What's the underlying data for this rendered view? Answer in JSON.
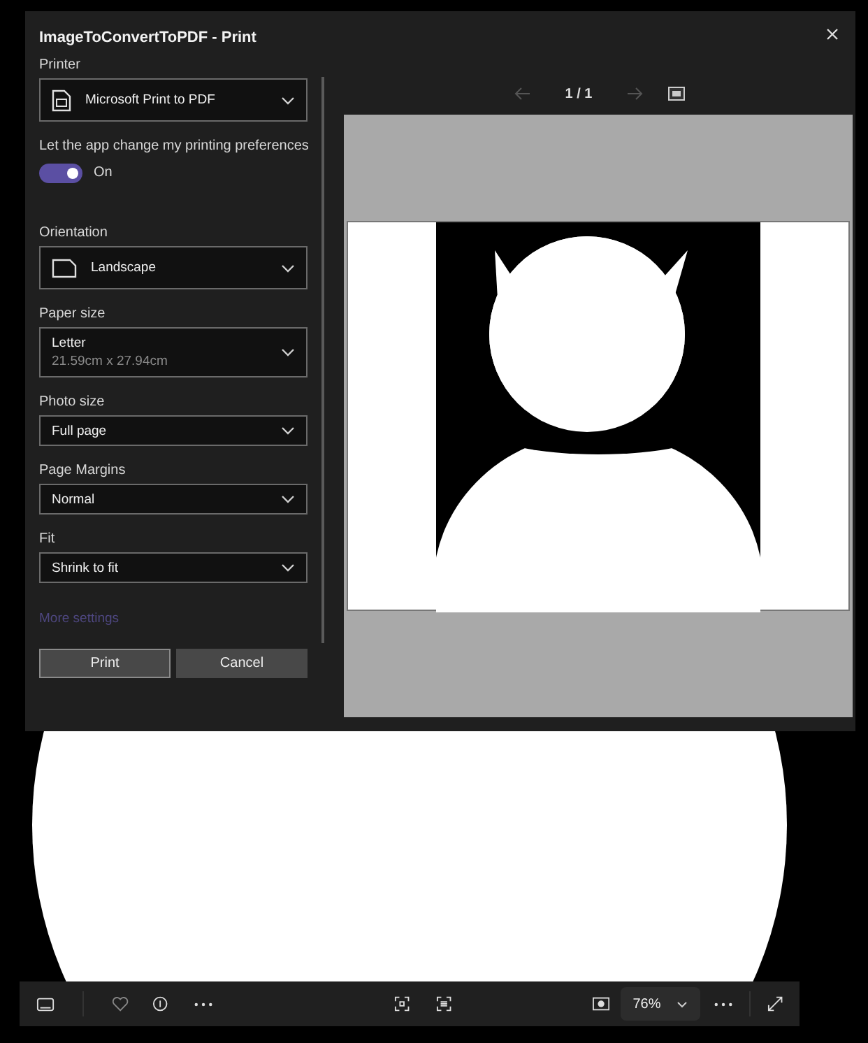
{
  "dialog": {
    "title": "ImageToConvertToPDF - Print",
    "settings": [
      {
        "kind": "dropdown",
        "label": "Printer",
        "value": "Microsoft Print to PDF"
      },
      {
        "kind": "toggle",
        "label": "Let the app change my printing preferences",
        "on": true,
        "state_text": "On"
      },
      {
        "kind": "dropdown",
        "label": "Orientation",
        "value": "Landscape"
      },
      {
        "kind": "dropdown",
        "label": "Paper size",
        "value": "Letter",
        "detail": "21.59cm x 27.94cm"
      },
      {
        "kind": "dropdown",
        "label": "Photo size",
        "value": "Full page"
      },
      {
        "kind": "dropdown",
        "label": "Page Margins",
        "value": "Normal"
      },
      {
        "kind": "dropdown",
        "label": "Fit",
        "value": "Shrink to fit"
      }
    ],
    "more_settings": {
      "label": "More settings",
      "disabled": true
    },
    "buttons": [
      {
        "label": "Print",
        "selected": true
      },
      {
        "label": "Cancel",
        "selected": false
      }
    ],
    "preview": {
      "page": "1 / 1",
      "prev_disabled": true,
      "next_disabled": true
    }
  },
  "viewer": {
    "zoom": "76%"
  }
}
